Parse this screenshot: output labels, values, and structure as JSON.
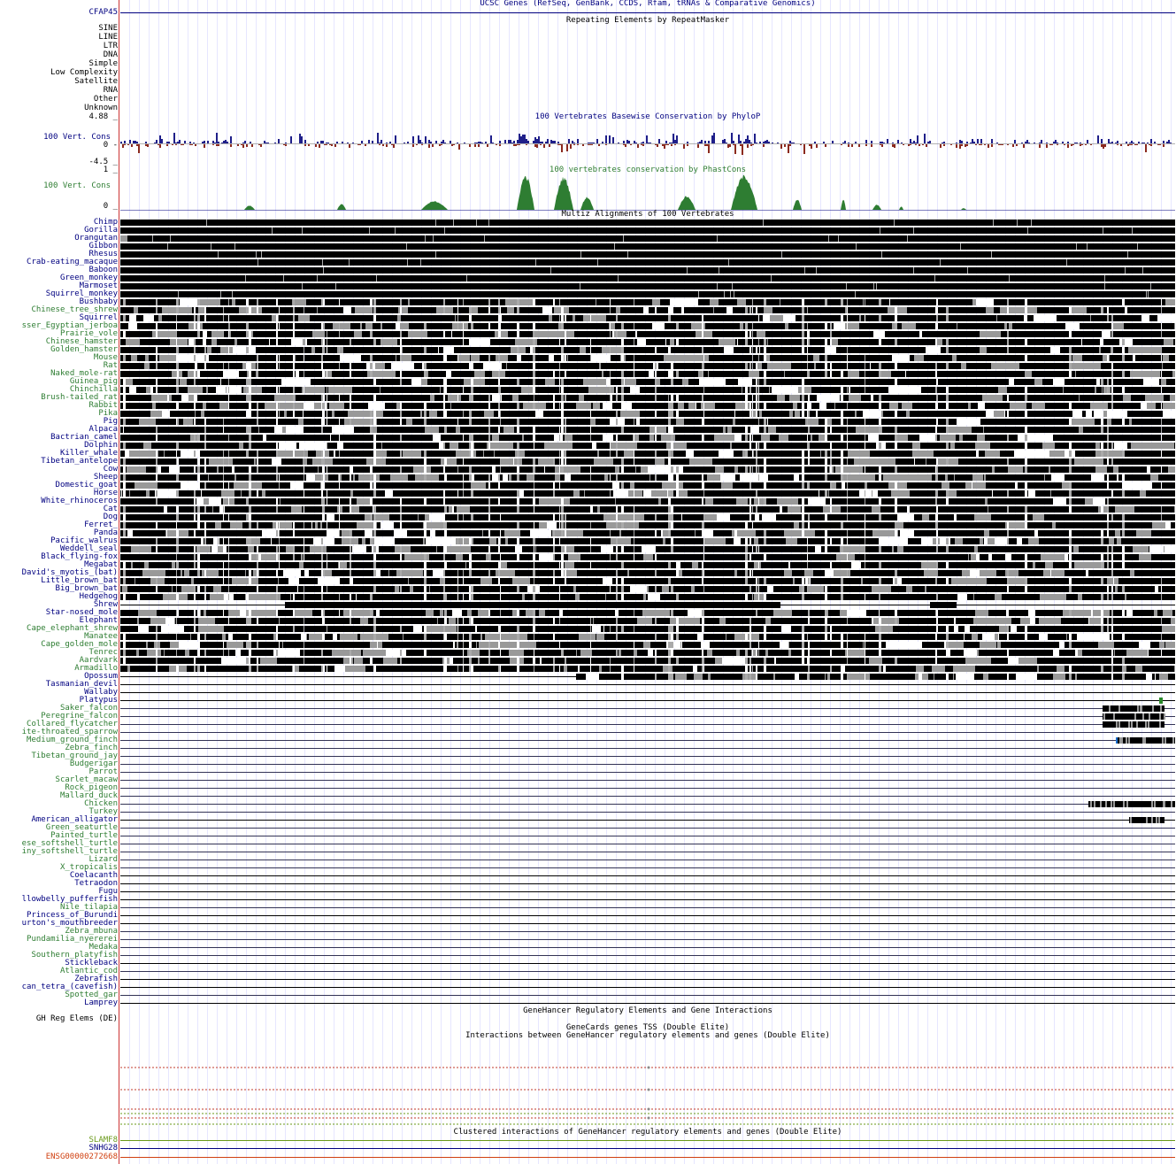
{
  "colors": {
    "blue": "#000080",
    "green": "#2e7d32",
    "phylop_pos": "#1f1f8a",
    "phylop_neg": "#8b2a1f",
    "phastcons": "#2e7d32",
    "red": "#b33",
    "orange": "#d04010",
    "lime": "#6a9a1a",
    "black": "#000000",
    "gray": "#999999"
  },
  "tracks": {
    "ucsc_genes_title": "UCSC Genes (RefSeq, GenBank, CCDS, Rfam, tRNAs & Comparative Genomics)",
    "gene_label": "CFAP45",
    "repeat_title": "Repeating Elements by RepeatMasker",
    "repeat_classes": [
      "SINE",
      "LINE",
      "LTR",
      "DNA",
      "Simple",
      "Low Complexity",
      "Satellite",
      "RNA",
      "Other",
      "Unknown"
    ],
    "phylop_title": "100 Vertebrates Basewise Conservation by PhyloP",
    "phylop_label": "100 Vert. Cons",
    "phylop_max": "4.88 _",
    "phylop_zero": "0 -",
    "phylop_min": "-4.5 _",
    "phastcons_title": "100 vertebrates conservation by PhastCons",
    "phastcons_label": "100 Vert. Cons",
    "phastcons_max": "1 _",
    "phastcons_zero": "0 _",
    "multiz_title": "Multiz Alignments of 100 Vertebrates",
    "genehancer_title": "GeneHancer Regulatory Elements and Gene Interactions",
    "gh_label": "GH Reg Elems (DE)",
    "genecards_title": "GeneCards genes TSS (Double Elite)",
    "interactions_title": "Interactions between GeneHancer regulatory elements and genes (Double Elite)",
    "clustered_title": "Clustered interactions of GeneHancer regulatory elements and genes (Double Elite)",
    "bottom_genes": [
      {
        "label": "SLAMF8",
        "color": "#6a9a1a"
      },
      {
        "label": "SNHG28",
        "color": "#000080"
      },
      {
        "label": "ENSG00000272668",
        "color": "#d04010"
      }
    ]
  },
  "species": [
    {
      "name": "Chimp",
      "c": "b",
      "t": "solid"
    },
    {
      "name": "Gorilla",
      "c": "b",
      "t": "solid"
    },
    {
      "name": "Orangutan",
      "c": "b",
      "t": "solid"
    },
    {
      "name": "Gibbon",
      "c": "b",
      "t": "solid"
    },
    {
      "name": "Rhesus",
      "c": "b",
      "t": "solid"
    },
    {
      "name": "Crab-eating_macaque",
      "c": "b",
      "t": "solid"
    },
    {
      "name": "Baboon",
      "c": "b",
      "t": "solid"
    },
    {
      "name": "Green_monkey",
      "c": "b",
      "t": "solid"
    },
    {
      "name": "Marmoset",
      "c": "b",
      "t": "solid"
    },
    {
      "name": "Squirrel_monkey",
      "c": "b",
      "t": "solid"
    },
    {
      "name": "Bushbaby",
      "c": "b",
      "t": "mixed"
    },
    {
      "name": "Chinese_tree_shrew",
      "c": "g",
      "t": "mixed"
    },
    {
      "name": "Squirrel",
      "c": "b",
      "t": "mixed"
    },
    {
      "name": "sser_Egyptian_jerboa",
      "c": "g",
      "t": "mixed"
    },
    {
      "name": "Prairie_vole",
      "c": "g",
      "t": "mixed"
    },
    {
      "name": "Chinese_hamster",
      "c": "g",
      "t": "mixed"
    },
    {
      "name": "Golden_hamster",
      "c": "g",
      "t": "mixed"
    },
    {
      "name": "Mouse",
      "c": "g",
      "t": "mixed"
    },
    {
      "name": "Rat",
      "c": "g",
      "t": "mixed"
    },
    {
      "name": "Naked_mole-rat",
      "c": "g",
      "t": "mixed"
    },
    {
      "name": "Guinea_pig",
      "c": "g",
      "t": "mixed"
    },
    {
      "name": "Chinchilla",
      "c": "g",
      "t": "mixed"
    },
    {
      "name": "Brush-tailed_rat",
      "c": "g",
      "t": "mixed"
    },
    {
      "name": "Rabbit",
      "c": "g",
      "t": "mixed"
    },
    {
      "name": "Pika",
      "c": "g",
      "t": "mixed"
    },
    {
      "name": "Pig",
      "c": "b",
      "t": "mixed"
    },
    {
      "name": "Alpaca",
      "c": "b",
      "t": "mixed"
    },
    {
      "name": "Bactrian_camel",
      "c": "b",
      "t": "mixed"
    },
    {
      "name": "Dolphin",
      "c": "b",
      "t": "mixed"
    },
    {
      "name": "Killer_whale",
      "c": "b",
      "t": "mixed"
    },
    {
      "name": "Tibetan_antelope",
      "c": "b",
      "t": "mixed"
    },
    {
      "name": "Cow",
      "c": "b",
      "t": "mixed"
    },
    {
      "name": "Sheep",
      "c": "b",
      "t": "mixed"
    },
    {
      "name": "Domestic_goat",
      "c": "b",
      "t": "mixed"
    },
    {
      "name": "Horse",
      "c": "b",
      "t": "mixed"
    },
    {
      "name": "White_rhinoceros",
      "c": "b",
      "t": "mixed"
    },
    {
      "name": "Cat",
      "c": "b",
      "t": "mixed"
    },
    {
      "name": "Dog",
      "c": "b",
      "t": "mixed"
    },
    {
      "name": "Ferret_",
      "c": "b",
      "t": "mixed"
    },
    {
      "name": "Panda",
      "c": "b",
      "t": "mixed"
    },
    {
      "name": "Pacific_walrus",
      "c": "b",
      "t": "mixed"
    },
    {
      "name": "Weddell_seal",
      "c": "b",
      "t": "mixed"
    },
    {
      "name": "Black_flying-fox",
      "c": "b",
      "t": "mixed"
    },
    {
      "name": "Megabat",
      "c": "b",
      "t": "mixed"
    },
    {
      "name": "David's_myotis_(bat)",
      "c": "b",
      "t": "mixed"
    },
    {
      "name": "Little_brown_bat",
      "c": "b",
      "t": "mixed"
    },
    {
      "name": "Big_brown_bat",
      "c": "b",
      "t": "mixed"
    },
    {
      "name": "Hedgehog",
      "c": "b",
      "t": "mixed"
    },
    {
      "name": "Shrew",
      "c": "b",
      "t": "partial"
    },
    {
      "name": "Star-nosed_mole",
      "c": "b",
      "t": "mixed"
    },
    {
      "name": "Elephant",
      "c": "b",
      "t": "mixed"
    },
    {
      "name": "Cape_elephant_shrew",
      "c": "g",
      "t": "mixed"
    },
    {
      "name": "Manatee",
      "c": "g",
      "t": "mixed"
    },
    {
      "name": "Cape_golden_mole",
      "c": "g",
      "t": "mixed"
    },
    {
      "name": "Tenrec",
      "c": "g",
      "t": "mixed"
    },
    {
      "name": "Aardvark",
      "c": "g",
      "t": "mixed"
    },
    {
      "name": "Armadillo",
      "c": "g",
      "t": "mixed"
    },
    {
      "name": "Opossum",
      "c": "b",
      "t": "opossum"
    },
    {
      "name": "Tasmanian_devil",
      "c": "b",
      "t": "line"
    },
    {
      "name": "Wallaby",
      "c": "b",
      "t": "line"
    },
    {
      "name": "Platypus",
      "c": "b",
      "t": "line"
    },
    {
      "name": "Saker_falcon",
      "c": "g",
      "t": "bird"
    },
    {
      "name": "Peregrine_falcon",
      "c": "g",
      "t": "bird"
    },
    {
      "name": "Collared_flycatcher",
      "c": "g",
      "t": "bird"
    },
    {
      "name": "ite-throated_sparrow",
      "c": "g",
      "t": "line"
    },
    {
      "name": "Medium_ground_finch",
      "c": "g",
      "t": "finch"
    },
    {
      "name": "Zebra_finch",
      "c": "g",
      "t": "line"
    },
    {
      "name": "Tibetan_ground_jay",
      "c": "g",
      "t": "line"
    },
    {
      "name": "Budgerigar",
      "c": "g",
      "t": "line"
    },
    {
      "name": "Parrot",
      "c": "g",
      "t": "line"
    },
    {
      "name": "Scarlet_macaw",
      "c": "g",
      "t": "line"
    },
    {
      "name": "Rock_pigeon",
      "c": "g",
      "t": "line"
    },
    {
      "name": "Mallard_duck",
      "c": "g",
      "t": "line"
    },
    {
      "name": "Chicken",
      "c": "g",
      "t": "chicken"
    },
    {
      "name": "Turkey",
      "c": "g",
      "t": "line"
    },
    {
      "name": "American_alligator",
      "c": "b",
      "t": "gator"
    },
    {
      "name": "Green_seaturtle",
      "c": "g",
      "t": "line"
    },
    {
      "name": "Painted_turtle",
      "c": "g",
      "t": "line"
    },
    {
      "name": "ese_softshell_turtle",
      "c": "g",
      "t": "line"
    },
    {
      "name": "iny_softshell_turtle",
      "c": "g",
      "t": "line"
    },
    {
      "name": "Lizard",
      "c": "g",
      "t": "line"
    },
    {
      "name": "X_tropicalis",
      "c": "g",
      "t": "line"
    },
    {
      "name": "Coelacanth",
      "c": "b",
      "t": "line"
    },
    {
      "name": "Tetraodon",
      "c": "b",
      "t": "line"
    },
    {
      "name": "Fugu",
      "c": "b",
      "t": "line"
    },
    {
      "name": "llowbelly_pufferfish",
      "c": "b",
      "t": "line"
    },
    {
      "name": "Nile_tilapia",
      "c": "g",
      "t": "line"
    },
    {
      "name": "Princess_of_Burundi",
      "c": "b",
      "t": "line"
    },
    {
      "name": "urton's_mouthbreeder",
      "c": "b",
      "t": "line"
    },
    {
      "name": "Zebra_mbuna",
      "c": "g",
      "t": "line"
    },
    {
      "name": "Pundamilia_nyererei",
      "c": "g",
      "t": "line"
    },
    {
      "name": "Medaka",
      "c": "g",
      "t": "line"
    },
    {
      "name": "Southern_platyfish",
      "c": "g",
      "t": "line"
    },
    {
      "name": "Stickleback",
      "c": "b",
      "t": "line"
    },
    {
      "name": "Atlantic_cod",
      "c": "g",
      "t": "line"
    },
    {
      "name": "Zebrafish",
      "c": "b",
      "t": "line"
    },
    {
      "name": "can_tetra_(cavefish)",
      "c": "b",
      "t": "line"
    },
    {
      "name": "Spotted_gar",
      "c": "g",
      "t": "line"
    },
    {
      "name": "Lamprey",
      "c": "b",
      "t": "line"
    }
  ]
}
